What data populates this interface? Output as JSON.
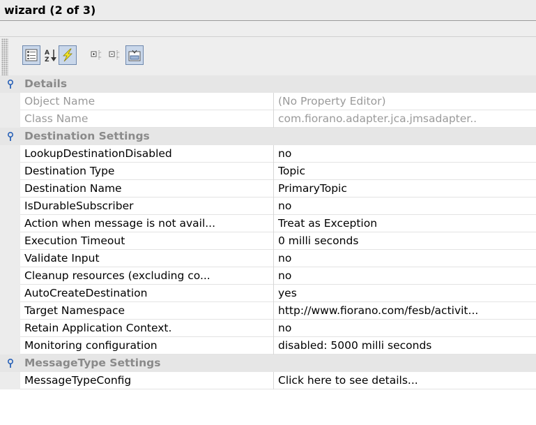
{
  "window": {
    "title": "wizard (2 of 3)"
  },
  "toolbar": {
    "buttons": [
      {
        "icon": "categorized-view-icon",
        "pressed": true
      },
      {
        "icon": "sort-alphabetical-icon",
        "pressed": false
      },
      {
        "icon": "lightning-icon",
        "pressed": true
      },
      {
        "icon": "expand-all-icon",
        "pressed": false
      },
      {
        "icon": "collapse-all-icon",
        "pressed": false
      },
      {
        "icon": "show-description-icon",
        "pressed": true
      }
    ]
  },
  "categories": {
    "details": {
      "label": "Details",
      "props": [
        {
          "name": "Object Name",
          "value": "(No Property Editor)"
        },
        {
          "name": "Class Name",
          "value": "com.fiorano.adapter.jca.jmsadapter.."
        }
      ]
    },
    "destination": {
      "label": "Destination Settings",
      "props": [
        {
          "name": "LookupDestinationDisabled",
          "value": "no"
        },
        {
          "name": "Destination Type",
          "value": "Topic"
        },
        {
          "name": "Destination Name",
          "value": "PrimaryTopic"
        },
        {
          "name": "IsDurableSubscriber",
          "value": "no"
        },
        {
          "name": "Action when message is not avail...",
          "value": "Treat as Exception"
        },
        {
          "name": "Execution Timeout",
          "value": "0 milli seconds"
        },
        {
          "name": "Validate Input",
          "value": "no"
        },
        {
          "name": "Cleanup resources (excluding co...",
          "value": "no"
        },
        {
          "name": "AutoCreateDestination",
          "value": "yes"
        },
        {
          "name": "Target Namespace",
          "value": "http://www.fiorano.com/fesb/activit..."
        },
        {
          "name": "Retain Application Context.",
          "value": "no"
        },
        {
          "name": "Monitoring configuration",
          "value": "disabled: 5000 milli seconds"
        }
      ]
    },
    "messagetype": {
      "label": "MessageType Settings",
      "props": [
        {
          "name": "MessageTypeConfig",
          "value": "Click here to see details..."
        }
      ]
    }
  },
  "colors": {
    "category_bg": "#e6e6e6",
    "pin_blue": "#2a62b8",
    "pressed_bg": "#c9d7ea",
    "lightning_yellow": "#f2e628"
  }
}
